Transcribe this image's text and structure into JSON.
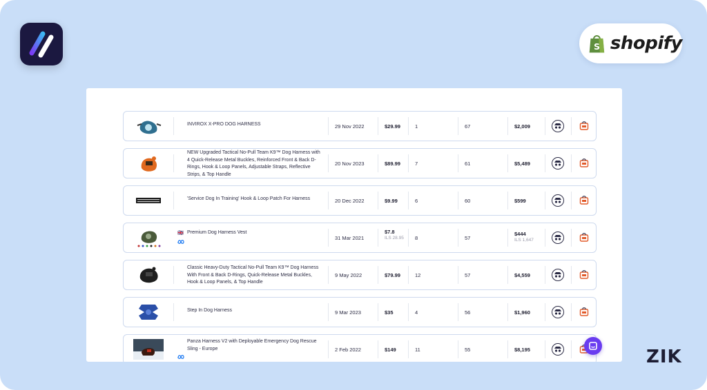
{
  "branding": {
    "shopify_label": "shopify",
    "zik_label": "ZIK"
  },
  "products": [
    {
      "name": "INVIROX X-PRO DOG HARNESS",
      "flag": "",
      "date": "29 Nov 2022",
      "price": "$29.99",
      "price_sub": "",
      "orders": "1",
      "count": "67",
      "revenue": "$2,009",
      "revenue_sub": ""
    },
    {
      "name": "NEW Upgraded Tactical No-Pull Team K9™ Dog Harness with 4 Quick-Release Metal Buckles, Reinforced Front & Back D-Rings, Hook & Loop Panels, Adjustable Straps, Reflective Strips, & Top Handle",
      "flag": "",
      "date": "20 Nov 2023",
      "price": "$89.99",
      "price_sub": "",
      "orders": "7",
      "count": "61",
      "revenue": "$5,489",
      "revenue_sub": ""
    },
    {
      "name": "'Service Dog In Training' Hook & Loop Patch For Harness",
      "flag": "",
      "date": "20 Dec 2022",
      "price": "$9.99",
      "price_sub": "",
      "orders": "6",
      "count": "60",
      "revenue": "$599",
      "revenue_sub": ""
    },
    {
      "name": "Premium Dog Harness Vest",
      "flag": "🇬🇧",
      "date": "31 Mar 2021",
      "price": "$7.8",
      "price_sub": "ILS 28.95",
      "orders": "8",
      "count": "57",
      "revenue": "$444",
      "revenue_sub": "ILS 1,647"
    },
    {
      "name": "Classic Heavy-Duty Tactical No-Pull Team K9™ Dog Harness With Front & Back D-Rings, Quick-Release Metal Buckles, Hook & Loop Panels, & Top Handle",
      "flag": "",
      "date": "9 May 2022",
      "price": "$79.99",
      "price_sub": "",
      "orders": "12",
      "count": "57",
      "revenue": "$4,559",
      "revenue_sub": ""
    },
    {
      "name": "Step In Dog Harness",
      "flag": "",
      "date": "9 Mar 2023",
      "price": "$35",
      "price_sub": "",
      "orders": "4",
      "count": "56",
      "revenue": "$1,960",
      "revenue_sub": ""
    },
    {
      "name": "Panza Harness V2 with Deployable Emergency Dog Rescue Sling - Europe",
      "flag": "",
      "date": "2 Feb 2022",
      "price": "$149",
      "price_sub": "",
      "orders": "11",
      "count": "55",
      "revenue": "$8,195",
      "revenue_sub": ""
    }
  ],
  "icons": {
    "app_logo": "app-logo-icon",
    "shopify_bag": "shopify-bag-icon",
    "spy": "spy-icon",
    "store": "store-icon",
    "chat": "chat-icon",
    "meta": "meta-icon"
  },
  "colors": {
    "background": "#c9def8",
    "row_border": "#cdd9ee",
    "chat": "#6a3cf0",
    "store_icon": "#e25b2a",
    "shopify_green": "#5e8e3e"
  }
}
